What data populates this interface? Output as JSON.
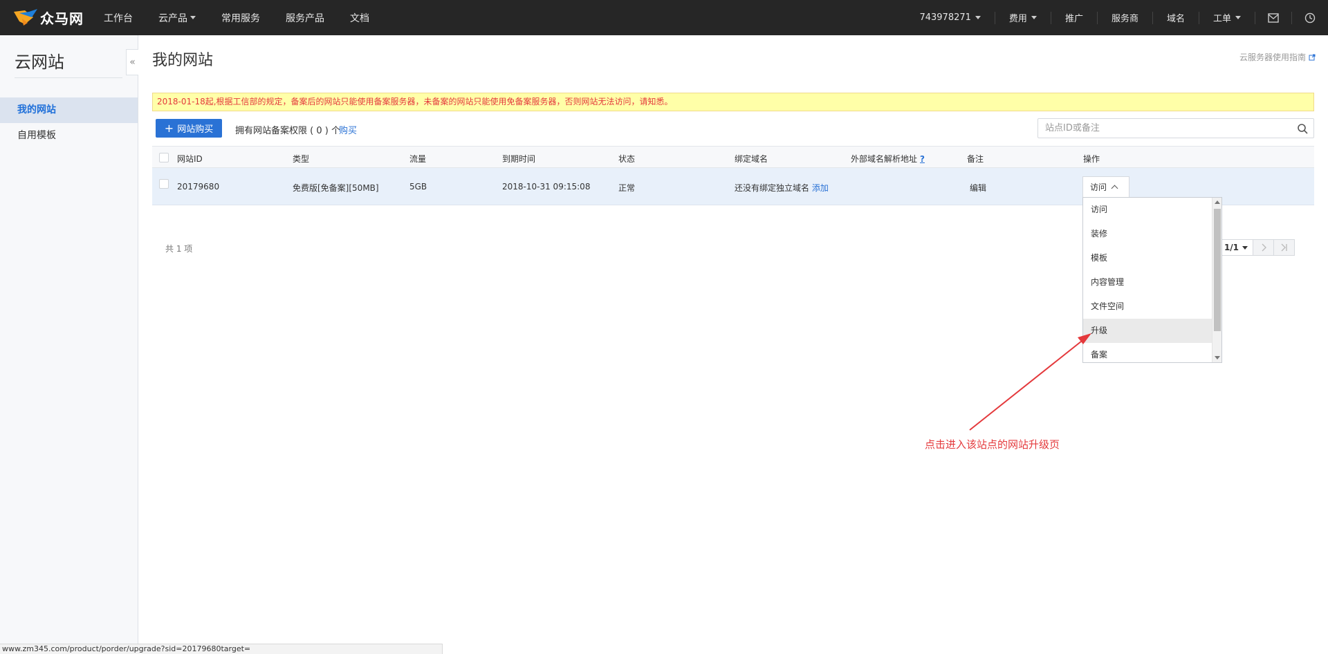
{
  "brand": {
    "name": "众马网"
  },
  "topnav": {
    "items": [
      "工作台",
      "云产品",
      "常用服务",
      "服务产品",
      "文档"
    ]
  },
  "topright": {
    "account": "743978271",
    "fees": "费用",
    "promote": "推广",
    "provider": "服务商",
    "domain": "域名",
    "ticket": "工单"
  },
  "sidebar": {
    "title": "云网站",
    "items": [
      {
        "label": "我的网站",
        "active": true
      },
      {
        "label": "自用模板",
        "active": false
      }
    ],
    "collapse_glyph": "«"
  },
  "main": {
    "title": "我的网站",
    "guide_link": "云服务器使用指南",
    "notice": "2018-01-18起,根据工信部的规定，备案后的网站只能使用备案服务器，未备案的网站只能使用免备案服务器，否则网站无法访问，请知悉。",
    "buy_button": "网站购买",
    "quota_text": "拥有网站备案权限 ( 0 ) 个",
    "quota_buy": "购买",
    "search_placeholder": "站点ID或备注",
    "total": "共 1 项",
    "page": "1/1"
  },
  "table": {
    "headers": [
      "网站ID",
      "类型",
      "流量",
      "到期时间",
      "状态",
      "绑定域名",
      "外部域名解析地址",
      "备注",
      "操作"
    ],
    "help_mark": "?",
    "rows": [
      {
        "id": "20179680",
        "type": "免费版[免备案][50MB]",
        "traffic": "5GB",
        "expire": "2018-10-31 09:15:08",
        "status": "正常",
        "domain_text": "还没有绑定独立域名",
        "domain_add": "添加",
        "external": "",
        "remark": "编辑"
      }
    ]
  },
  "operation_dropdown": {
    "trigger": "访问",
    "options": [
      "访问",
      "装修",
      "模板",
      "内容管理",
      "文件空间",
      "升级",
      "备案"
    ],
    "hovered": "升级"
  },
  "annotation": {
    "text": "点击进入该站点的网站升级页",
    "color": "#e4393c"
  },
  "statusbar": {
    "url": "www.zm345.com/product/porder/upgrade?sid=20179680target="
  },
  "colors": {
    "topbar": "#262626",
    "accent": "#2a72d5",
    "notice_bg": "#ffffa8",
    "notice_text": "#e4393c",
    "row_bg": "#e8f0fa"
  }
}
